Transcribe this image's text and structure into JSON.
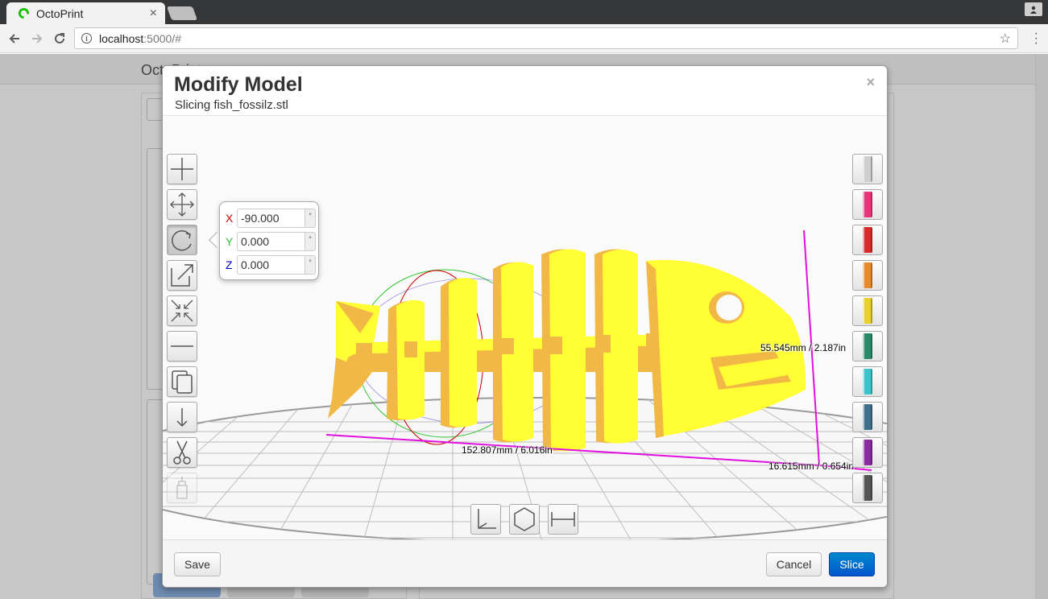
{
  "browser": {
    "tab_title": "OctoPrint",
    "url_host": "localhost",
    "url_rest": ":5000/#",
    "tab_close": "×"
  },
  "background": {
    "brand": "OctoPrint"
  },
  "modal": {
    "title": "Modify Model",
    "subtitle": "Slicing fish_fossilz.stl",
    "close": "×",
    "footer": {
      "save_label": "Save",
      "cancel_label": "Cancel",
      "slice_label": "Slice"
    }
  },
  "tools": [
    {
      "name": "add-icon"
    },
    {
      "name": "move-icon"
    },
    {
      "name": "rotate-icon",
      "active": true
    },
    {
      "name": "scale-icon"
    },
    {
      "name": "center-icon"
    },
    {
      "name": "lay-flat-icon"
    },
    {
      "name": "copy-icon"
    },
    {
      "name": "drop-icon"
    },
    {
      "name": "cut-icon"
    },
    {
      "name": "support-icon",
      "disabled": true
    }
  ],
  "rotation": {
    "x_label": "X",
    "y_label": "Y",
    "z_label": "Z",
    "x_value": "-90.000",
    "y_value": "0.000",
    "z_value": "0.000",
    "unit": "°",
    "colors": {
      "x": "#d10000",
      "y": "#2ec52e",
      "z": "#0000cc"
    }
  },
  "filament_colors": [
    "#cfcfcf",
    "#e8357c",
    "#d92b2b",
    "#e88a2c",
    "#e8d12c",
    "#2b8a6a",
    "#3cc4cc",
    "#3f6f8a",
    "#8a2ba0",
    "#555555"
  ],
  "dimensions": {
    "length": "152.807mm / 6.016in",
    "height": "55.545mm / 2.187in",
    "depth": "16.615mm / 0.654in"
  },
  "view_buttons": [
    "axes-view-icon",
    "object-view-icon",
    "dimensions-view-icon"
  ],
  "colors": {
    "model": "#ffff33",
    "model_shade": "#f2b845",
    "dimension_line": "#e010e0",
    "primary": "#0066cc"
  }
}
